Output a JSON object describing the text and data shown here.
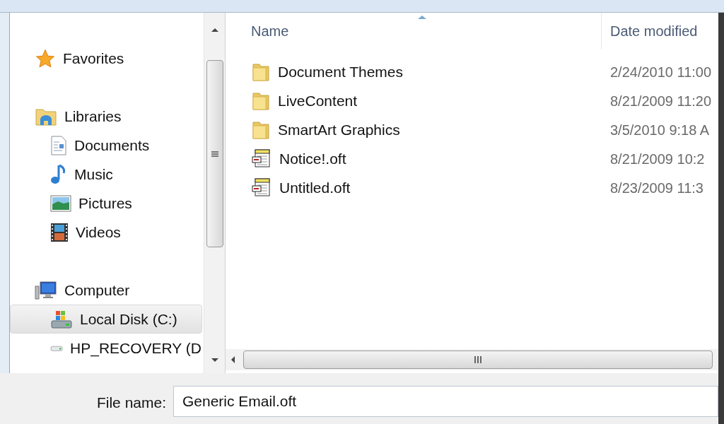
{
  "navigation": [
    {
      "label": "Favorites",
      "kind": "favorites",
      "selected": false
    },
    {
      "label": "Libraries",
      "kind": "libraries",
      "selected": false,
      "children": [
        {
          "label": "Documents",
          "kind": "documents",
          "selected": false
        },
        {
          "label": "Music",
          "kind": "music",
          "selected": false
        },
        {
          "label": "Pictures",
          "kind": "pictures",
          "selected": false
        },
        {
          "label": "Videos",
          "kind": "videos",
          "selected": false
        }
      ]
    },
    {
      "label": "Computer",
      "kind": "computer",
      "selected": false,
      "children": [
        {
          "label": "Local Disk (C:)",
          "kind": "system-drive",
          "selected": true
        },
        {
          "label": "HP_RECOVERY (D",
          "kind": "drive",
          "selected": false
        }
      ]
    }
  ],
  "file_list": {
    "columns": [
      "Name",
      "Date modified"
    ],
    "rows": [
      {
        "name": "Document Themes",
        "date": "2/24/2010 11:00",
        "kind": "folder"
      },
      {
        "name": "LiveContent",
        "date": "8/21/2009 11:20",
        "kind": "folder"
      },
      {
        "name": "SmartArt Graphics",
        "date": "3/5/2010 9:18 A",
        "kind": "folder"
      },
      {
        "name": "Notice!.oft",
        "date": "8/21/2009 10:2",
        "kind": "template"
      },
      {
        "name": "Untitled.oft",
        "date": "8/23/2009 11:3",
        "kind": "template"
      }
    ]
  },
  "file_name": {
    "label": "File name:",
    "value": "Generic Email.oft"
  }
}
